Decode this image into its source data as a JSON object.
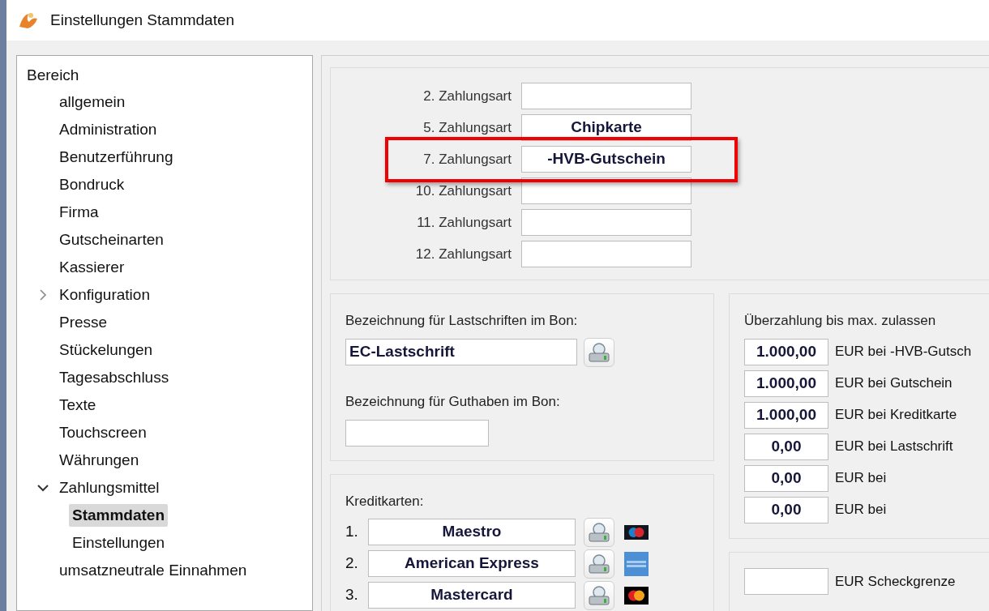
{
  "window": {
    "title": "Einstellungen Stammdaten"
  },
  "tree": {
    "header": "Bereich",
    "items": [
      {
        "label": "allgemein",
        "selected": false
      },
      {
        "label": "Administration",
        "selected": false
      },
      {
        "label": "Benutzerführung",
        "selected": false
      },
      {
        "label": "Bondruck",
        "selected": false
      },
      {
        "label": "Firma",
        "selected": false
      },
      {
        "label": "Gutscheinarten",
        "selected": false
      },
      {
        "label": "Kassierer",
        "selected": false
      },
      {
        "label": "Konfiguration",
        "selected": false,
        "expanded": false
      },
      {
        "label": "Presse",
        "selected": false
      },
      {
        "label": "Stückelungen",
        "selected": false
      },
      {
        "label": "Tagesabschluss",
        "selected": false
      },
      {
        "label": "Texte",
        "selected": false
      },
      {
        "label": "Touchscreen",
        "selected": false
      },
      {
        "label": "Währungen",
        "selected": false
      },
      {
        "label": "Zahlungsmittel",
        "selected": false,
        "expanded": true,
        "children": [
          {
            "label": "Stammdaten",
            "selected": true
          },
          {
            "label": "Einstellungen",
            "selected": false
          }
        ]
      },
      {
        "label": "umsatzneutrale Einnahmen",
        "selected": false
      }
    ]
  },
  "payment_types": [
    {
      "label": "2. Zahlungsart",
      "highlighted": false
    },
    {
      "label": "5. Zahlungsart",
      "value": "Chipkarte",
      "highlighted": false
    },
    {
      "label": "7. Zahlungsart",
      "value": "-HVB-Gutschein",
      "highlighted": true
    },
    {
      "label": "10. Zahlungsart",
      "highlighted": false
    },
    {
      "label": "11. Zahlungsart",
      "highlighted": false
    },
    {
      "label": "12. Zahlungsart",
      "highlighted": false
    }
  ],
  "receipt": {
    "debit_label": "Bezeichnung für Lastschriften im Bon:",
    "debit_value": "EC-Lastschrift",
    "credit_label": "Bezeichnung für Guthaben im Bon:"
  },
  "credit_cards": {
    "label": "Kreditkarten:",
    "cards": [
      {
        "number": "1.",
        "name": "Maestro",
        "kind": "maestro"
      },
      {
        "number": "2.",
        "name": "American Express",
        "kind": "amex"
      },
      {
        "number": "3.",
        "name": "Mastercard",
        "kind": "mastercard"
      }
    ]
  },
  "overpayment": {
    "title": "Überzahlung bis max. zulassen",
    "rows": [
      {
        "amount": "1.000,00",
        "label": "EUR bei -HVB-Gutsch"
      },
      {
        "amount": "1.000,00",
        "label": "EUR bei Gutschein"
      },
      {
        "amount": "1.000,00",
        "label": "EUR bei Kreditkarte"
      },
      {
        "amount": "0,00",
        "label": "EUR bei Lastschrift"
      },
      {
        "amount": "0,00",
        "label": "EUR bei"
      },
      {
        "amount": "0,00",
        "label": "EUR bei"
      }
    ]
  },
  "limits": {
    "rows": [
      {
        "label": "EUR Scheckgrenze"
      }
    ]
  }
}
